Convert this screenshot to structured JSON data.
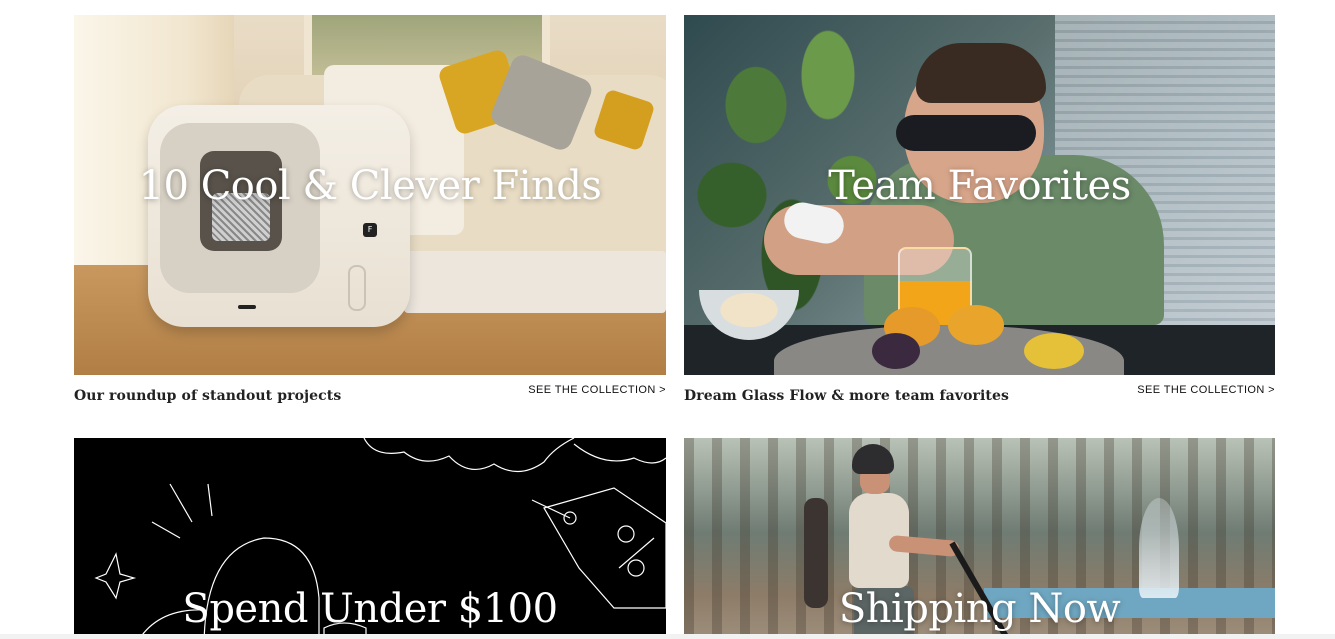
{
  "cards": [
    {
      "title": "10 Cool & Clever Finds",
      "caption": "Our roundup of standout projects",
      "link": "SEE THE COLLECTION >"
    },
    {
      "title": "Team Favorites",
      "caption": "Dream Glass Flow & more team favorites",
      "link": "SEE THE COLLECTION >"
    },
    {
      "title": "Spend Under $100"
    },
    {
      "title": "Shipping Now"
    }
  ],
  "device_badge": "F"
}
